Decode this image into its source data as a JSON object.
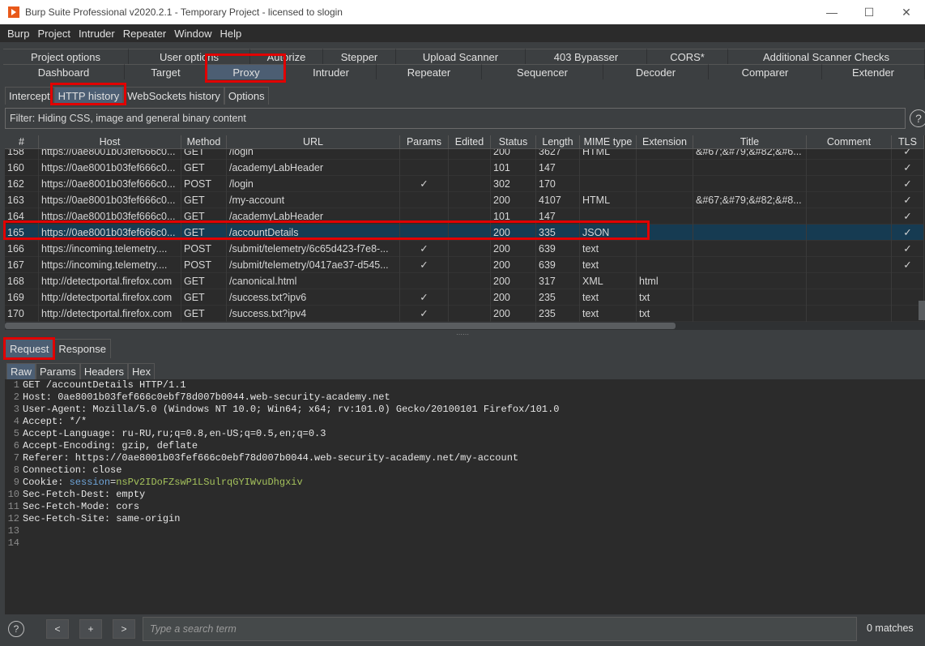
{
  "window": {
    "title": "Burp Suite Professional v2020.2.1 - Temporary Project - licensed to slogin",
    "controls": [
      "—",
      "☐",
      "✕"
    ]
  },
  "menu": [
    "Burp",
    "Project",
    "Intruder",
    "Repeater",
    "Window",
    "Help"
  ],
  "tabs_row1": [
    "Project options",
    "User options",
    "Autorize",
    "Stepper",
    "Upload Scanner",
    "403 Bypasser",
    "CORS*",
    "Additional Scanner Checks"
  ],
  "tabs_row2": [
    "Dashboard",
    "Target",
    "Proxy",
    "Intruder",
    "Repeater",
    "Sequencer",
    "Decoder",
    "Comparer",
    "Extender"
  ],
  "proxy_subtabs": [
    "Intercept",
    "HTTP history",
    "WebSockets history",
    "Options"
  ],
  "filter": "Filter: Hiding CSS, image and general binary content",
  "help_icon": "?",
  "table": {
    "columns": [
      "#",
      "Host",
      "Method",
      "URL",
      "Params",
      "Edited",
      "Status",
      "Length",
      "MIME type",
      "Extension",
      "Title",
      "Comment",
      "TLS"
    ],
    "rows": [
      {
        "num": "158",
        "host": "https://0ae8001b03fef666c0...",
        "method": "GET",
        "url": "/login",
        "params": "",
        "edited": "",
        "status": "200",
        "length": "3627",
        "mime": "HTML",
        "ext": "",
        "title": "&#67;&#79;&#82;&#6...",
        "comment": "",
        "tls": "✓"
      },
      {
        "num": "160",
        "host": "https://0ae8001b03fef666c0...",
        "method": "GET",
        "url": "/academyLabHeader",
        "params": "",
        "edited": "",
        "status": "101",
        "length": "147",
        "mime": "",
        "ext": "",
        "title": "",
        "comment": "",
        "tls": "✓"
      },
      {
        "num": "162",
        "host": "https://0ae8001b03fef666c0...",
        "method": "POST",
        "url": "/login",
        "params": "✓",
        "edited": "",
        "status": "302",
        "length": "170",
        "mime": "",
        "ext": "",
        "title": "",
        "comment": "",
        "tls": "✓"
      },
      {
        "num": "163",
        "host": "https://0ae8001b03fef666c0...",
        "method": "GET",
        "url": "/my-account",
        "params": "",
        "edited": "",
        "status": "200",
        "length": "4107",
        "mime": "HTML",
        "ext": "",
        "title": "&#67;&#79;&#82;&#8...",
        "comment": "",
        "tls": "✓"
      },
      {
        "num": "164",
        "host": "https://0ae8001b03fef666c0...",
        "method": "GET",
        "url": "/academyLabHeader",
        "params": "",
        "edited": "",
        "status": "101",
        "length": "147",
        "mime": "",
        "ext": "",
        "title": "",
        "comment": "",
        "tls": "✓"
      },
      {
        "num": "165",
        "host": "https://0ae8001b03fef666c0...",
        "method": "GET",
        "url": "/accountDetails",
        "params": "",
        "edited": "",
        "status": "200",
        "length": "335",
        "mime": "JSON",
        "ext": "",
        "title": "",
        "comment": "",
        "tls": "✓",
        "selected": true
      },
      {
        "num": "166",
        "host": "https://incoming.telemetry....",
        "method": "POST",
        "url": "/submit/telemetry/6c65d423-f7e8-...",
        "params": "✓",
        "edited": "",
        "status": "200",
        "length": "639",
        "mime": "text",
        "ext": "",
        "title": "",
        "comment": "",
        "tls": "✓"
      },
      {
        "num": "167",
        "host": "https://incoming.telemetry....",
        "method": "POST",
        "url": "/submit/telemetry/0417ae37-d545...",
        "params": "✓",
        "edited": "",
        "status": "200",
        "length": "639",
        "mime": "text",
        "ext": "",
        "title": "",
        "comment": "",
        "tls": "✓"
      },
      {
        "num": "168",
        "host": "http://detectportal.firefox.com",
        "method": "GET",
        "url": "/canonical.html",
        "params": "",
        "edited": "",
        "status": "200",
        "length": "317",
        "mime": "XML",
        "ext": "html",
        "title": "",
        "comment": "",
        "tls": ""
      },
      {
        "num": "169",
        "host": "http://detectportal.firefox.com",
        "method": "GET",
        "url": "/success.txt?ipv6",
        "params": "✓",
        "edited": "",
        "status": "200",
        "length": "235",
        "mime": "text",
        "ext": "txt",
        "title": "",
        "comment": "",
        "tls": ""
      },
      {
        "num": "170",
        "host": "http://detectportal.firefox.com",
        "method": "GET",
        "url": "/success.txt?ipv4",
        "params": "✓",
        "edited": "",
        "status": "200",
        "length": "235",
        "mime": "text",
        "ext": "txt",
        "title": "",
        "comment": "",
        "tls": ""
      }
    ]
  },
  "message_tabs": [
    "Request",
    "Response"
  ],
  "view_tabs": [
    "Raw",
    "Params",
    "Headers",
    "Hex"
  ],
  "request_lines": [
    "GET /accountDetails HTTP/1.1",
    "Host: 0ae8001b03fef666c0ebf78d007b0044.web-security-academy.net",
    "User-Agent: Mozilla/5.0 (Windows NT 10.0; Win64; x64; rv:101.0) Gecko/20100101 Firefox/101.0",
    "Accept: */*",
    "Accept-Language: ru-RU,ru;q=0.8,en-US;q=0.5,en;q=0.3",
    "Accept-Encoding: gzip, deflate",
    "Referer: https://0ae8001b03fef666c0ebf78d007b0044.web-security-academy.net/my-account",
    "Connection: close",
    "Cookie: ",
    "Sec-Fetch-Dest: empty",
    "Sec-Fetch-Mode: cors",
    "Sec-Fetch-Site: same-origin",
    "",
    ""
  ],
  "cookie": {
    "key": "session",
    "eq": "=",
    "value": "nsPv2IDoFZswP1LSulrqGYIWvuDhgxiv"
  },
  "bottom": {
    "help": "?",
    "prev": "<",
    "add": "+",
    "next": ">",
    "search_placeholder": "Type a search term",
    "matches": "0 matches"
  }
}
